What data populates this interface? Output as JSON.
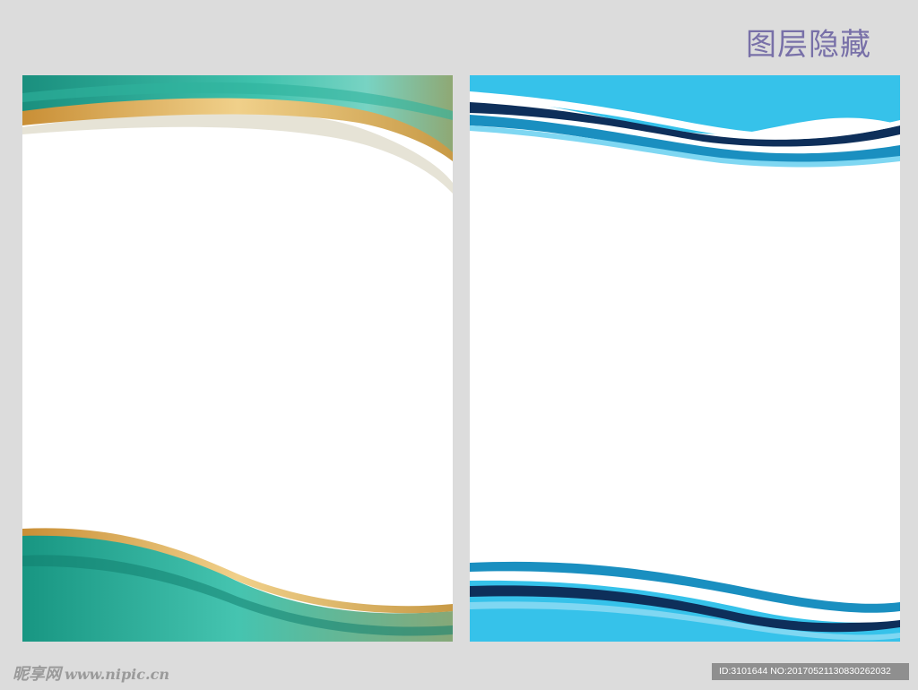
{
  "header": {
    "title": "图层隐藏"
  },
  "watermark": {
    "brand": "昵享网",
    "url": "www.nipic.cn"
  },
  "id_label": "ID:3101644 NO:20170521130830262032",
  "colors": {
    "background": "#dcdcdc",
    "green_wave": "#1e9e8a",
    "gold_band": "#d4a456",
    "blue_wave": "#36c2ea",
    "navy_stripe": "#0e2f5a"
  }
}
